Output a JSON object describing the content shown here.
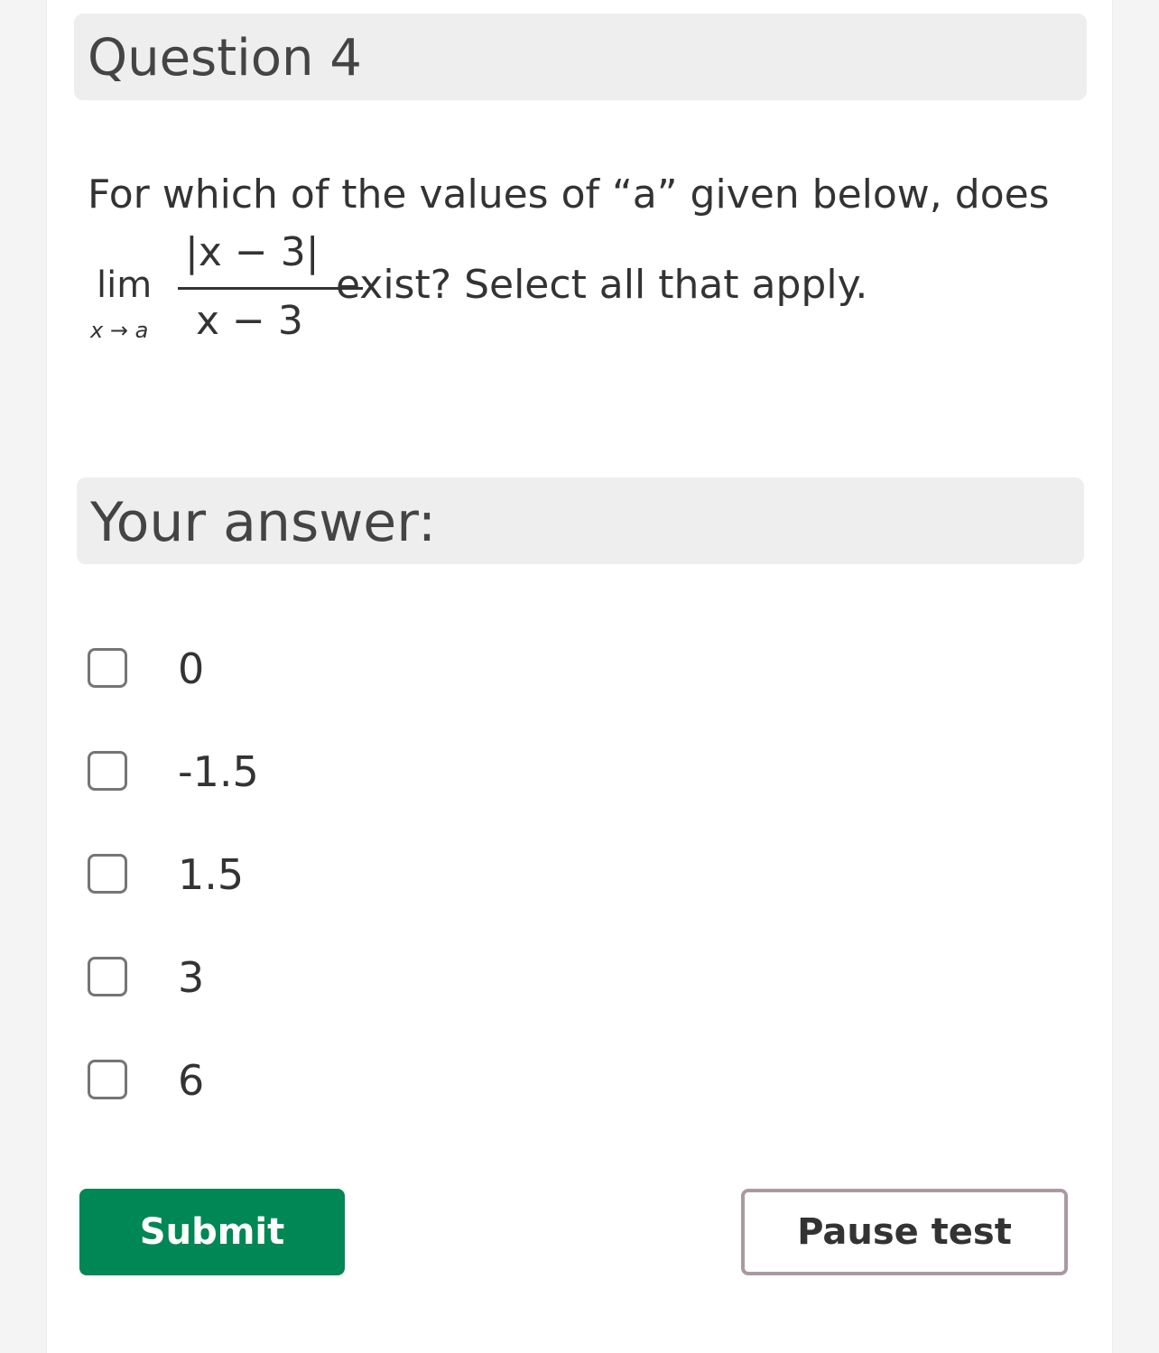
{
  "question": {
    "title": "Question 4",
    "prompt_line1": "For which of the values of “a” given below, does",
    "formula": {
      "lim": "lim",
      "subscript": "x → a",
      "numerator": "|x − 3|",
      "denominator": "x − 3"
    },
    "prompt_line2": "exist? Select all that apply."
  },
  "answer": {
    "header": "Your answer:",
    "options": [
      {
        "label": "0",
        "checked": false
      },
      {
        "label": "-1.5",
        "checked": false
      },
      {
        "label": "1.5",
        "checked": false
      },
      {
        "label": "3",
        "checked": false
      },
      {
        "label": "6",
        "checked": false
      }
    ]
  },
  "buttons": {
    "submit": "Submit",
    "pause": "Pause test"
  },
  "colors": {
    "submit_bg": "#008756",
    "pause_border": "#a89aa3",
    "header_bg": "#eeeeee"
  }
}
